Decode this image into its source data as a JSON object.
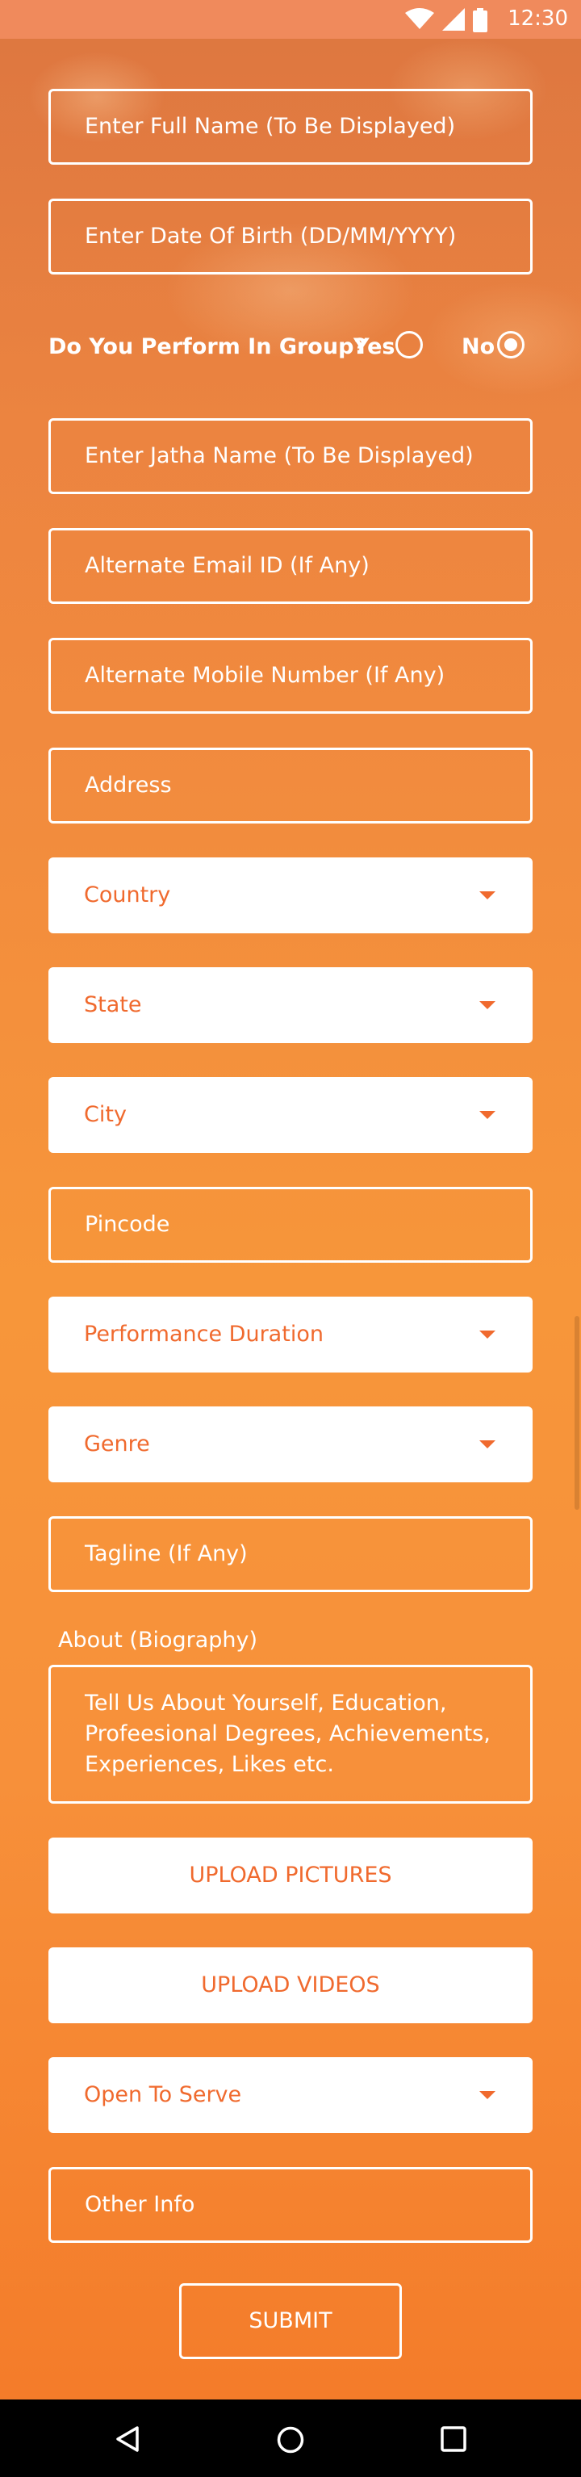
{
  "status_bar": {
    "time": "12:30"
  },
  "form": {
    "full_name_placeholder": "Enter Full Name (To Be Displayed)",
    "dob_placeholder": "Enter Date Of Birth (DD/MM/YYYY)",
    "group_question": "Do You Perform In Group?",
    "group_yes": "Yes",
    "group_no": "No",
    "group_selected": "No",
    "jatha_placeholder": "Enter Jatha Name (To Be Displayed)",
    "alt_email_placeholder": "Alternate Email ID (If Any)",
    "alt_mobile_placeholder": "Alternate Mobile Number (If Any)",
    "address_placeholder": "Address",
    "country": "Country",
    "state": "State",
    "city": "City",
    "pincode_placeholder": "Pincode",
    "performance_duration": "Performance Duration",
    "genre": "Genre",
    "tagline_placeholder": "Tagline (If Any)",
    "about_label": "About (Biography)",
    "about_placeholder": "Tell Us About Yourself, Education, Profeesional Degrees, Achievements, Experiences, Likes etc.",
    "upload_pictures": "UPLOAD PICTURES",
    "upload_videos": "UPLOAD VIDEOS",
    "open_to_serve": "Open To Serve",
    "other_info_placeholder": "Other Info",
    "submit": "SUBMIT"
  },
  "colors": {
    "accent": "#f06a2e",
    "background_top": "#f0803a",
    "background_bottom": "#f47c2a"
  },
  "icons": {
    "wifi": "wifi-icon",
    "signal": "cell-signal-icon",
    "battery": "battery-icon",
    "back": "back-icon",
    "home": "home-icon",
    "recents": "recents-icon"
  }
}
